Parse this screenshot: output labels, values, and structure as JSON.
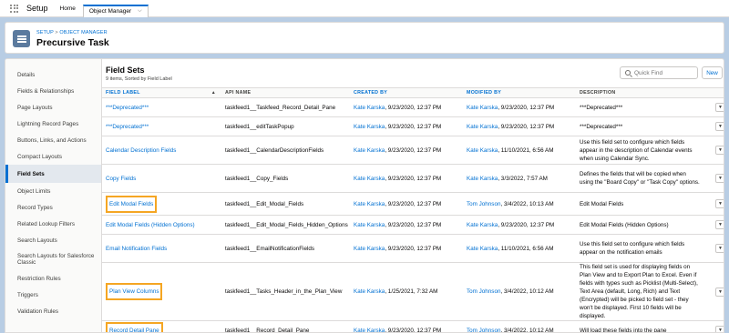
{
  "topnav": {
    "app_name": "Setup",
    "tabs": [
      {
        "label": "Home"
      },
      {
        "label": "Object Manager"
      }
    ]
  },
  "header": {
    "breadcrumb_setup": "SETUP",
    "breadcrumb_sep": " > ",
    "breadcrumb_object_manager": "OBJECT MANAGER",
    "title": "Precursive Task"
  },
  "sidebar": {
    "items": [
      {
        "label": "Details"
      },
      {
        "label": "Fields & Relationships"
      },
      {
        "label": "Page Layouts"
      },
      {
        "label": "Lightning Record Pages"
      },
      {
        "label": "Buttons, Links, and Actions"
      },
      {
        "label": "Compact Layouts"
      },
      {
        "label": "Field Sets"
      },
      {
        "label": "Object Limits"
      },
      {
        "label": "Record Types"
      },
      {
        "label": "Related Lookup Filters"
      },
      {
        "label": "Search Layouts"
      },
      {
        "label": "Search Layouts for Salesforce Classic"
      },
      {
        "label": "Restriction Rules"
      },
      {
        "label": "Triggers"
      },
      {
        "label": "Validation Rules"
      }
    ],
    "active_index": 6
  },
  "main": {
    "title": "Field Sets",
    "subtitle": "9 items, Sorted by Field Label",
    "quick_find_placeholder": "Quick Find",
    "new_label": "New",
    "columns": {
      "field_label": "FIELD LABEL",
      "api_name": "API NAME",
      "created_by": "CREATED BY",
      "modified_by": "MODIFIED BY",
      "description": "DESCRIPTION"
    },
    "rows": [
      {
        "label": "***Deprecated***",
        "api": "taskfeed1__Taskfeed_Record_Detail_Pane",
        "created": "Kate Karska",
        "created_date": ", 9/23/2020, 12:37 PM",
        "modified": "Kate Karska",
        "modified_date": ", 9/23/2020, 12:37 PM",
        "description": "***Deprecated***",
        "highlight": false
      },
      {
        "label": "***Deprecated***",
        "api": "taskfeed1__editTaskPopup",
        "created": "Kate Karska",
        "created_date": ", 9/23/2020, 12:37 PM",
        "modified": "Kate Karska",
        "modified_date": ", 9/23/2020, 12:37 PM",
        "description": "***Deprecated***",
        "highlight": false
      },
      {
        "label": "Calendar Description Fields",
        "api": "taskfeed1__CalendarDescriptionFields",
        "created": "Kate Karska",
        "created_date": ", 9/23/2020, 12:37 PM",
        "modified": "Kate Karska",
        "modified_date": ", 11/10/2021, 6:56 AM",
        "description": "Use this field set to configure which fields appear in the description of Calendar events when using Calendar Sync.",
        "highlight": false
      },
      {
        "label": "Copy Fields",
        "api": "taskfeed1__Copy_Fields",
        "created": "Kate Karska",
        "created_date": ", 9/23/2020, 12:37 PM",
        "modified": "Kate Karska",
        "modified_date": ", 3/3/2022, 7:57 AM",
        "description": "Defines the fields that will be copied when using the \"Board Copy\" or \"Task Copy\" options.",
        "highlight": false
      },
      {
        "label": "Edit Modal Fields",
        "api": "taskfeed1__Edit_Modal_Fields",
        "created": "Kate Karska",
        "created_date": ", 9/23/2020, 12:37 PM",
        "modified": "Tom Johnson",
        "modified_date": ", 3/4/2022, 10:13 AM",
        "description": "Edit Modal Fields",
        "highlight": true
      },
      {
        "label": "Edit Modal Fields (Hidden Options)",
        "api": "taskfeed1__Edit_Modal_Fields_Hidden_Options",
        "created": "Kate Karska",
        "created_date": ", 9/23/2020, 12:37 PM",
        "modified": "Kate Karska",
        "modified_date": ", 9/23/2020, 12:37 PM",
        "description": "Edit Modal Fields (Hidden Options)",
        "highlight": false
      },
      {
        "label": "Email Notification Fields",
        "api": "taskfeed1__EmailNotificationFields",
        "created": "Kate Karska",
        "created_date": ", 9/23/2020, 12:37 PM",
        "modified": "Kate Karska",
        "modified_date": ", 11/10/2021, 6:56 AM",
        "description": "Use this field set to configure which fields appear on the notification emails",
        "highlight": false
      },
      {
        "label": "Plan View Columns",
        "api": "taskfeed1__Tasks_Header_in_the_Plan_View",
        "created": "Kate Karska",
        "created_date": ", 1/25/2021, 7:32 AM",
        "modified": "Tom Johnson",
        "modified_date": ", 3/4/2022, 10:12 AM",
        "description": "This field set is used for displaying fields on Plan View and to Export Plan to Excel. Even if fields with types such as Picklist (Multi-Select), Text Area (default, Long, Rich) and Text (Encrypted) will be picked to field set - they won't be displayed. First 10 fields will be displayed.",
        "highlight": true
      },
      {
        "label": "Record Detail Pane",
        "api": "taskfeed1__Record_Detail_Pane",
        "created": "Kate Karska",
        "created_date": ", 9/23/2020, 12:37 PM",
        "modified": "Tom Johnson",
        "modified_date": ", 3/4/2022, 10:12 AM",
        "description": "Will load these fields into the pane",
        "highlight": true
      }
    ]
  },
  "colors": {
    "link": "#0070d2",
    "highlight": "#f5a623",
    "page_bg": "#b8cde4"
  }
}
